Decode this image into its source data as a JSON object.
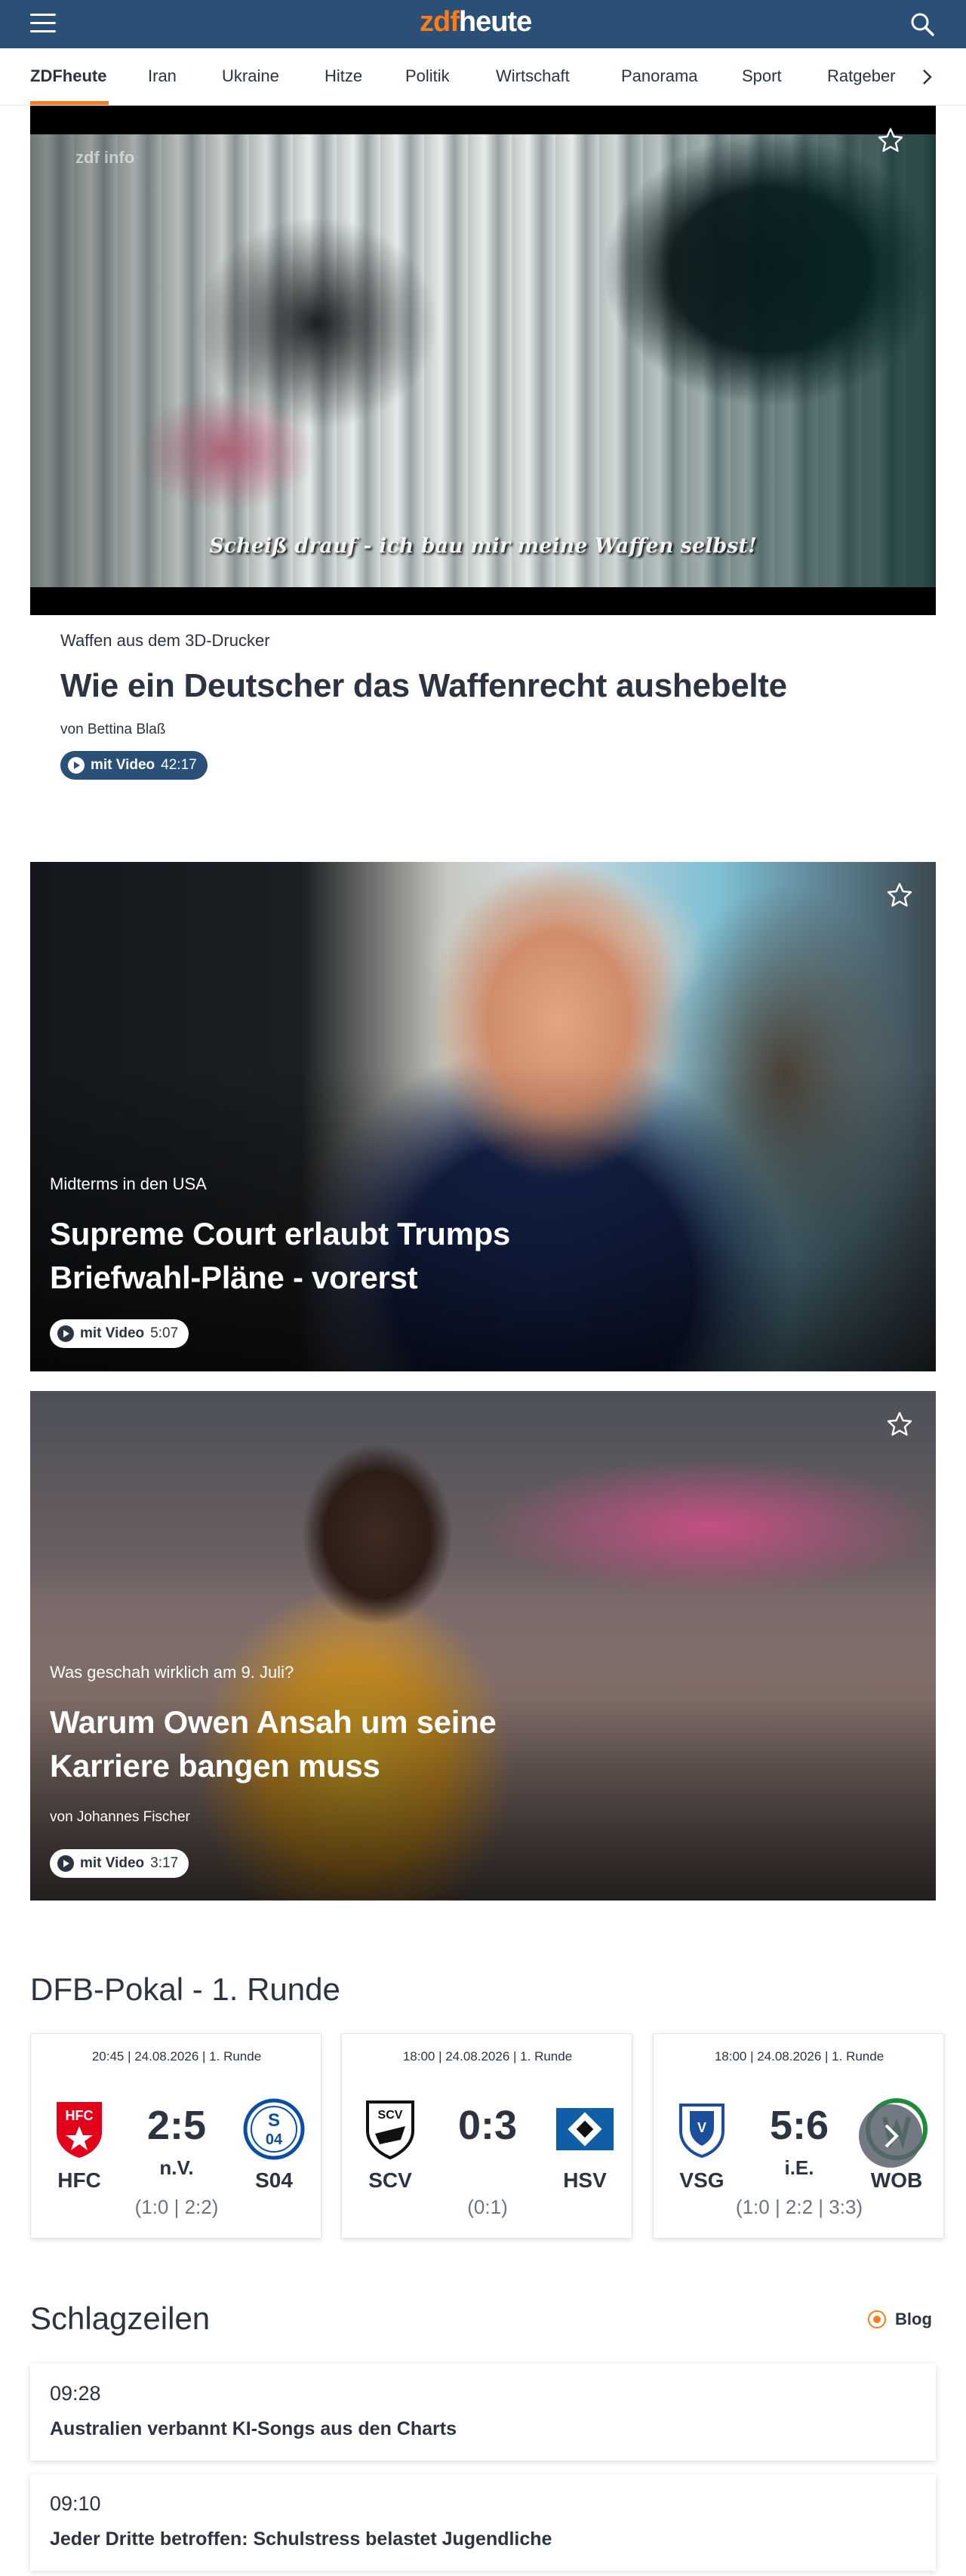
{
  "header": {
    "logo_prefix": "zdf",
    "logo_suffix": "heute",
    "accent_color": "#fa7d19",
    "bar_color": "#2a5078",
    "icons": [
      "menu-icon",
      "search-icon"
    ]
  },
  "nav": {
    "items": [
      "ZDFheute",
      "Iran",
      "Ukraine",
      "Hitze",
      "Politik",
      "Wirtschaft",
      "Panorama",
      "Sport",
      "Ratgeber"
    ],
    "active": "ZDFheute",
    "more_icon": "chevron-right-icon"
  },
  "hero": {
    "watermark": "zdf info",
    "subtitle": "Scheiß drauf - ich bau mir meine Waffen selbst!",
    "kicker": "Waffen aus dem 3D-Drucker",
    "headline": "Wie ein Deutscher das Waffenrecht aushebelte",
    "author": "von Bettina Blaß",
    "video_label": "mit Video",
    "video_duration": "42:17"
  },
  "teasers": [
    {
      "kicker": "Midterms in den USA",
      "headline_line1": "Supreme Court erlaubt Trumps",
      "headline_line2": "Briefwahl-Pläne - vorerst",
      "video_label": "mit Video",
      "video_duration": "5:07"
    },
    {
      "kicker": "Was geschah wirklich am 9. Juli?",
      "headline_line1": "Warum Owen Ansah um seine",
      "headline_line2": "Karriere bangen muss",
      "author": "von Johannes Fischer",
      "video_label": "mit Video",
      "video_duration": "3:17"
    }
  ],
  "scoreboard": {
    "title": "DFB-Pokal - 1. Runde",
    "matches": [
      {
        "meta": "20:45 | 24.08.2026 | 1. Runde",
        "home": "HFC",
        "away": "S04",
        "score": "2:5",
        "suffix": "n.V.",
        "halftime": "(1:0 | 2:2)"
      },
      {
        "meta": "18:00 | 24.08.2026 | 1. Runde",
        "home": "SCV",
        "away": "HSV",
        "score": "0:3",
        "suffix": "",
        "halftime": "(0:1)"
      },
      {
        "meta": "18:00 | 24.08.2026 | 1. Runde",
        "home": "VSG",
        "away": "WOB",
        "score": "5:6",
        "suffix": "i.E.",
        "halftime": "(1:0 | 2:2 | 3:3)"
      }
    ]
  },
  "headlines": {
    "title": "Schlagzeilen",
    "blog_label": "Blog",
    "items": [
      {
        "time": "09:28",
        "title": "Australien verbannt KI-Songs aus den Charts"
      },
      {
        "time": "09:10",
        "title": "Jeder Dritte betroffen: Schulstress belastet Jugendliche"
      }
    ]
  }
}
